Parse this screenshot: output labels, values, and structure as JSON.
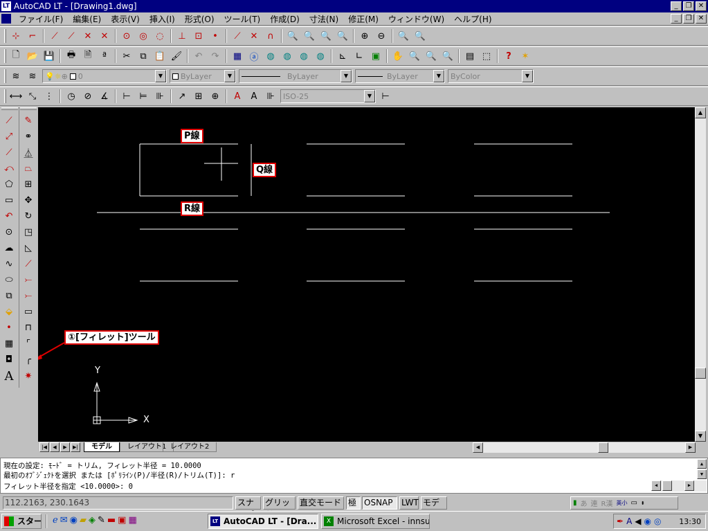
{
  "window": {
    "title": "AutoCAD LT - [Drawing1.dwg]",
    "app_icon": "LT"
  },
  "menu": [
    "ファイル(F)",
    "編集(E)",
    "表示(V)",
    "挿入(I)",
    "形式(O)",
    "ツール(T)",
    "作成(D)",
    "寸法(N)",
    "修正(M)",
    "ウィンドウ(W)",
    "ヘルプ(H)"
  ],
  "properties": {
    "layer": "0",
    "color": "ByLayer",
    "linetype": "ByLayer",
    "lineweight": "ByLayer",
    "plotstyle": "ByColor"
  },
  "dimstyle": "ISO-25",
  "callouts": {
    "p": "P線",
    "q": "Q線",
    "r": "R線",
    "tool": "①[フィレット]ツール"
  },
  "axes": {
    "x": "X",
    "y": "Y"
  },
  "tabs": [
    "モデル",
    "レイアウト1",
    "レイアウト2"
  ],
  "command_lines": [
    "現在の設定: ﾓｰﾄﾞ = トリム, フィレット半径 = 10.0000",
    "最初のｵﾌﾞｼﾞｪｸﾄを選択 または [ﾎﾟﾘﾗｲﾝ(P)/半径(R)/トリム(T)]: r",
    "フィレット半径を指定 <10.0000>: 0"
  ],
  "status": {
    "coords": "112.2163, 230.1643",
    "toggles": [
      "スナップ",
      "グリッド",
      "直交モード",
      "極",
      "OSNAP",
      "LWT",
      "モデル"
    ]
  },
  "taskbar": {
    "start": "スタート",
    "tasks": [
      "AutoCAD LT - [Dra...",
      "Microsoft Excel - innsut..."
    ],
    "ime": [
      "あ",
      "連",
      "R漢",
      "英小"
    ],
    "clock": "13:30"
  },
  "colors": {
    "titlebar": "#000080",
    "canvas": "#000000",
    "callout_border": "#e00000"
  }
}
